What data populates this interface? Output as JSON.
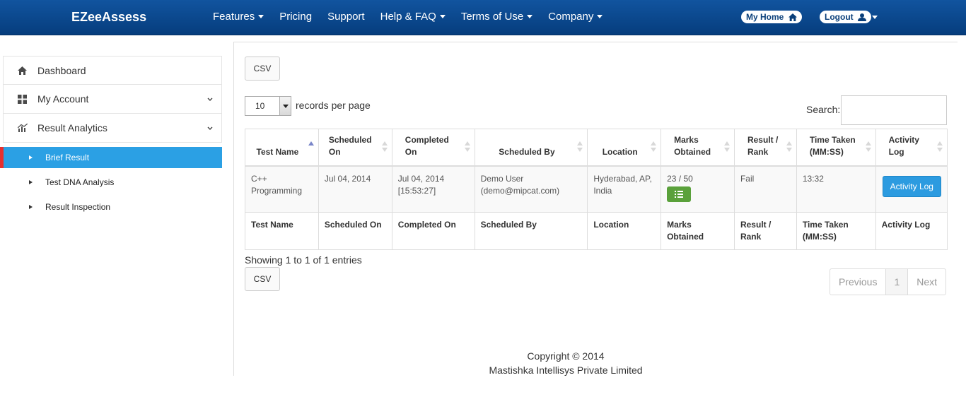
{
  "navbar": {
    "brand": "EZeeAssess",
    "items": [
      {
        "label": "Features",
        "dropdown": true
      },
      {
        "label": "Pricing",
        "dropdown": false
      },
      {
        "label": "Support",
        "dropdown": false
      },
      {
        "label": "Help & FAQ",
        "dropdown": true
      },
      {
        "label": "Terms of Use",
        "dropdown": true
      },
      {
        "label": "Company",
        "dropdown": true
      }
    ],
    "my_home": "My Home",
    "logout": "Logout"
  },
  "sidebar": {
    "items": [
      {
        "label": "Dashboard",
        "icon": "home-icon"
      },
      {
        "label": "My Account",
        "icon": "grid-icon"
      },
      {
        "label": "Result Analytics",
        "icon": "bar-chart-icon"
      }
    ],
    "subitems": [
      {
        "label": "Brief Result",
        "active": true
      },
      {
        "label": "Test DNA Analysis",
        "active": false
      },
      {
        "label": "Result Inspection",
        "active": false
      }
    ]
  },
  "toolbar": {
    "csv_label": "CSV"
  },
  "table_controls": {
    "per_page_value": "10",
    "per_page_label": "records per page",
    "search_label": "Search:"
  },
  "table": {
    "headers": [
      "Test Name",
      "Scheduled On",
      "Completed On",
      "Scheduled By",
      "Location",
      "Marks Obtained",
      "Result / Rank",
      "Time Taken (MM:SS)",
      "Activity Log"
    ],
    "rows": [
      {
        "test_name": "C++ Programming",
        "scheduled_on": "Jul 04, 2014",
        "completed_on": "Jul 04, 2014",
        "completed_time": "[15:53:27]",
        "scheduled_by": "Demo User",
        "scheduled_by_email": "(demo@mipcat.com)",
        "location": "Hyderabad, AP, India",
        "marks": "23 / 50",
        "result": "Fail",
        "time_taken": "13:32",
        "activity_button": "Activity Log"
      }
    ],
    "footers": [
      "Test Name",
      "Scheduled On",
      "Completed On",
      "Scheduled By",
      "Location",
      "Marks Obtained",
      "Result / Rank",
      "Time Taken (MM:SS)",
      "Activity Log"
    ]
  },
  "info": {
    "showing": "Showing 1 to 1 of 1 entries"
  },
  "pagination": {
    "previous": "Previous",
    "current": "1",
    "next": "Next"
  },
  "footer": {
    "copyright": "Copyright © 2014",
    "company": "Mastishka Intellisys Private Limited"
  }
}
